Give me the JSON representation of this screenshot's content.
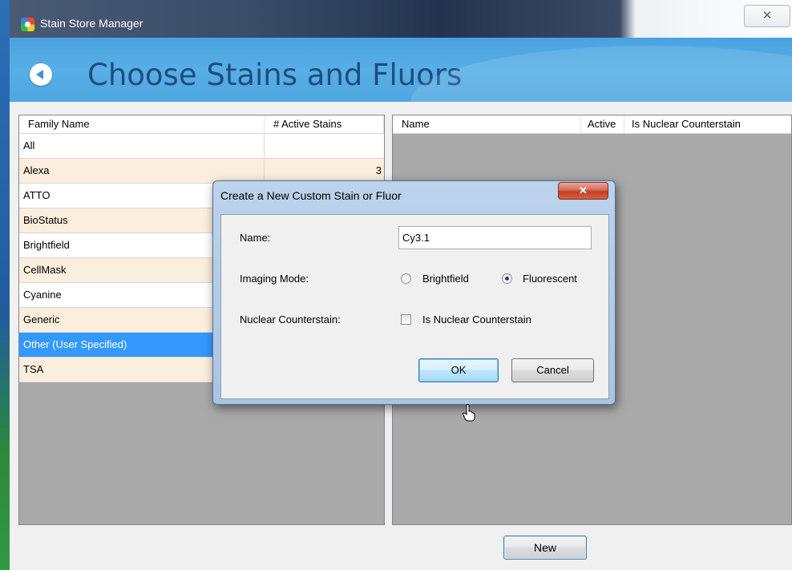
{
  "window": {
    "title": "Stain Store Manager",
    "close_glyph": "✕"
  },
  "header": {
    "title": "Choose Stains and Fluors"
  },
  "left_grid": {
    "columns": [
      "Family Name",
      "# Active Stains"
    ],
    "rows": [
      {
        "name": "All",
        "count": ""
      },
      {
        "name": "Alexa",
        "count": "3"
      },
      {
        "name": "ATTO",
        "count": ""
      },
      {
        "name": "BioStatus",
        "count": ""
      },
      {
        "name": "Brightfield",
        "count": ""
      },
      {
        "name": "CellMask",
        "count": ""
      },
      {
        "name": "Cyanine",
        "count": ""
      },
      {
        "name": "Generic",
        "count": ""
      },
      {
        "name": "Other (User Specified)",
        "count": ""
      },
      {
        "name": "TSA",
        "count": ""
      }
    ],
    "selected_index": 8
  },
  "right_grid": {
    "columns": [
      "Name",
      "Active",
      "Is Nuclear Counterstain"
    ]
  },
  "footer": {
    "new_label": "New"
  },
  "dialog": {
    "title": "Create a New Custom Stain or Fluor",
    "close_glyph": "✕",
    "name_label": "Name:",
    "name_value": "Cy3.1",
    "imaging_mode_label": "Imaging Mode:",
    "imaging_options": [
      "Brightfield",
      "Fluorescent"
    ],
    "imaging_selected": "Fluorescent",
    "nuclear_label": "Nuclear Counterstain:",
    "nuclear_checkbox_label": "Is Nuclear Counterstain",
    "nuclear_checked": false,
    "ok_label": "OK",
    "cancel_label": "Cancel"
  },
  "colors": {
    "header_band": "#4ea6e2",
    "title_text": "#1f4d80",
    "row_alt": "#fbeedc",
    "selection": "#3399ff",
    "grid_empty": "#a9a9a9"
  }
}
